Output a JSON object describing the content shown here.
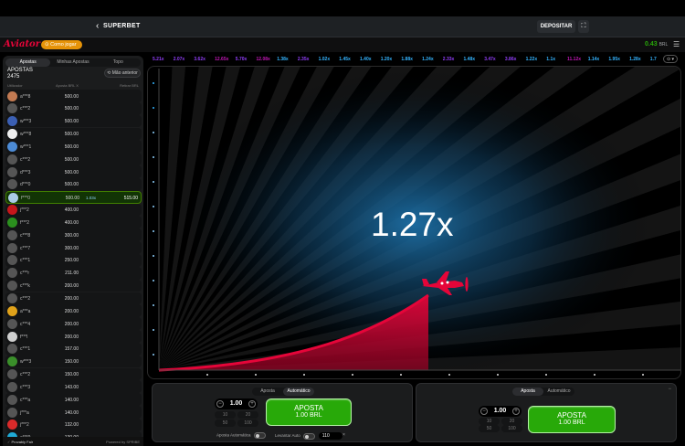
{
  "header": {
    "back_glyph": "‹",
    "brand": "SUPERBET",
    "deposit_label": "DEPOSITAR",
    "fullscreen_glyph": "⛶"
  },
  "aviator_bar": {
    "logo": "Aviator",
    "how_to_play": "⊙ Como jogar",
    "balance_value": "0.43",
    "balance_currency": "BRL",
    "menu_glyph": "☰"
  },
  "sidebar": {
    "tabs": [
      {
        "label": "Apostas",
        "active": true
      },
      {
        "label": "Minhas Apostas",
        "active": false
      },
      {
        "label": "Topo",
        "active": false
      }
    ],
    "bets_title": "APOSTAS",
    "bets_count": "2475",
    "previous_label": "⟲ Mão anterior",
    "col_player": "Utilizador",
    "col_bet": "Aposta BRL   X",
    "col_win": "Retirar BRL",
    "rows": [
      {
        "user": "a***8",
        "amount": "500.00",
        "avatar": "#c27a52"
      },
      {
        "user": "c***2",
        "amount": "500.00",
        "avatar": "#555"
      },
      {
        "user": "w***3",
        "amount": "500.00",
        "avatar": "#3b5fb3"
      },
      {
        "user": "w***8",
        "amount": "500.00",
        "avatar": "#eeeeee"
      },
      {
        "user": "w***1",
        "amount": "500.00",
        "avatar": "#4c8bd6"
      },
      {
        "user": "c***2",
        "amount": "500.00",
        "avatar": "#555"
      },
      {
        "user": "d***3",
        "amount": "500.00",
        "avatar": "#555"
      },
      {
        "user": "d***0",
        "amount": "500.00",
        "avatar": "#555"
      },
      {
        "user": "f***0",
        "amount": "500.00",
        "avatar": "#aacbe6",
        "multiplier": "1.03x",
        "win": "515.00"
      },
      {
        "user": "j***2",
        "amount": "400.00",
        "avatar": "#c6161b"
      },
      {
        "user": "f***2",
        "amount": "400.00",
        "avatar": "#2b8f1e"
      },
      {
        "user": "c***8",
        "amount": "300.00",
        "avatar": "#555"
      },
      {
        "user": "c***7",
        "amount": "300.00",
        "avatar": "#555"
      },
      {
        "user": "c***1",
        "amount": "250.00",
        "avatar": "#555"
      },
      {
        "user": "c***r",
        "amount": "211.00",
        "avatar": "#555"
      },
      {
        "user": "c***k",
        "amount": "200.00",
        "avatar": "#555"
      },
      {
        "user": "c***2",
        "amount": "200.00",
        "avatar": "#555"
      },
      {
        "user": "a***a",
        "amount": "200.00",
        "avatar": "#e0a21a"
      },
      {
        "user": "c***4",
        "amount": "200.00",
        "avatar": "#555"
      },
      {
        "user": "f***l",
        "amount": "200.00",
        "avatar": "#cfcfcf"
      },
      {
        "user": "c***1",
        "amount": "157.00",
        "avatar": "#555"
      },
      {
        "user": "w***3",
        "amount": "150.00",
        "avatar": "#3a8f2a"
      },
      {
        "user": "c***2",
        "amount": "150.00",
        "avatar": "#555"
      },
      {
        "user": "c***3",
        "amount": "143.00",
        "avatar": "#555"
      },
      {
        "user": "c***a",
        "amount": "140.00",
        "avatar": "#555"
      },
      {
        "user": "j***a",
        "amount": "140.00",
        "avatar": "#555"
      },
      {
        "user": "j***2",
        "amount": "132.00",
        "avatar": "#d92a2a"
      },
      {
        "user": "a***9",
        "amount": "130.00",
        "avatar": "#1faad6"
      }
    ],
    "footer_fair": "Provably Fair",
    "footer_powered": "Powered by SPRIBE"
  },
  "history": [
    {
      "v": "5.21x",
      "c": "#913ef8"
    },
    {
      "v": "2.07x",
      "c": "#913ef8"
    },
    {
      "v": "3.62x",
      "c": "#913ef8"
    },
    {
      "v": "12.65x",
      "c": "#c017b4"
    },
    {
      "v": "5.70x",
      "c": "#913ef8"
    },
    {
      "v": "12.08x",
      "c": "#c017b4"
    },
    {
      "v": "1.38x",
      "c": "#34b4ff"
    },
    {
      "v": "2.35x",
      "c": "#913ef8"
    },
    {
      "v": "1.02x",
      "c": "#34b4ff"
    },
    {
      "v": "1.45x",
      "c": "#34b4ff"
    },
    {
      "v": "1.40x",
      "c": "#34b4ff"
    },
    {
      "v": "1.20x",
      "c": "#34b4ff"
    },
    {
      "v": "1.88x",
      "c": "#34b4ff"
    },
    {
      "v": "1.24x",
      "c": "#34b4ff"
    },
    {
      "v": "2.33x",
      "c": "#913ef8"
    },
    {
      "v": "1.48x",
      "c": "#34b4ff"
    },
    {
      "v": "3.47x",
      "c": "#913ef8"
    },
    {
      "v": "3.86x",
      "c": "#913ef8"
    },
    {
      "v": "1.22x",
      "c": "#34b4ff"
    },
    {
      "v": "1.1x",
      "c": "#34b4ff"
    },
    {
      "v": "11.12x",
      "c": "#c017b4"
    },
    {
      "v": "1.14x",
      "c": "#34b4ff"
    },
    {
      "v": "1.95x",
      "c": "#34b4ff"
    },
    {
      "v": "1.28x",
      "c": "#34b4ff"
    },
    {
      "v": "1.7",
      "c": "#34b4ff"
    }
  ],
  "history_more": "⊙ ▾",
  "game": {
    "multiplier": "1.27x",
    "accent": "#e50539"
  },
  "panel1": {
    "tabs": [
      {
        "label": "Aposta",
        "active": false
      },
      {
        "label": "Automático",
        "active": true
      }
    ],
    "stake": "1.00",
    "quick": [
      "10",
      "20",
      "50",
      "100"
    ],
    "bet_l1": "APOSTA",
    "bet_l2": "1.00 BRL",
    "auto_bet_label": "Aposta Automática",
    "auto_cash_label": "Levantar Auto",
    "auto_cash_value": "110",
    "auto_cash_x": "×"
  },
  "panel2": {
    "tabs": [
      {
        "label": "Aposta",
        "active": true
      },
      {
        "label": "Automático",
        "active": false
      }
    ],
    "stake": "1.00",
    "quick": [
      "10",
      "20",
      "50",
      "100"
    ],
    "bet_l1": "APOSTA",
    "bet_l2": "1.00 BRL",
    "more": "−"
  }
}
